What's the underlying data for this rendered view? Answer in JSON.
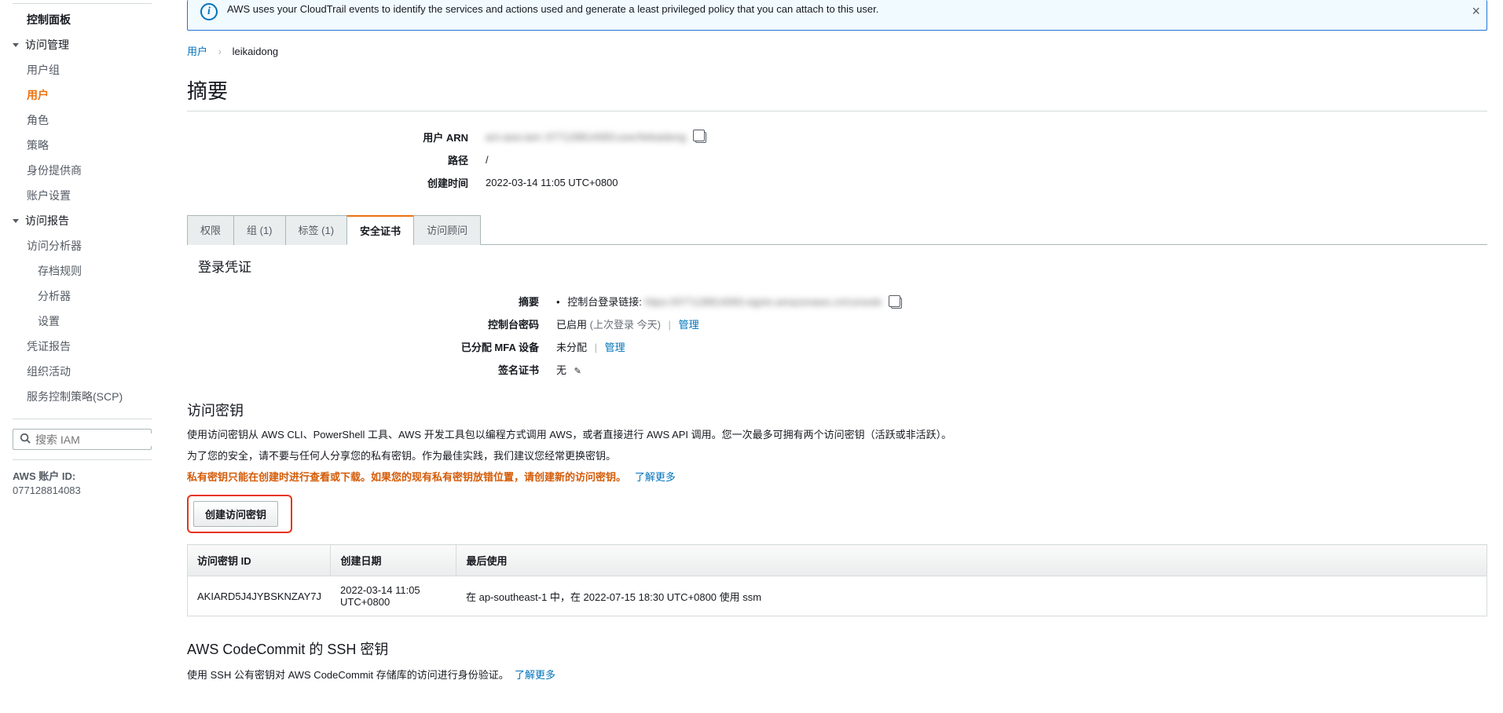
{
  "banner": {
    "text": "AWS uses your CloudTrail events to identify the services and actions used and generate a least privileged policy that you can attach to this user."
  },
  "sidebar": {
    "dashboard": "控制面板",
    "accessMgmt": "访问管理",
    "userGroups": "用户组",
    "users": "用户",
    "roles": "角色",
    "policies": "策略",
    "idProviders": "身份提供商",
    "accountSettings": "账户设置",
    "accessReports": "访问报告",
    "accessAnalyzer": "访问分析器",
    "archiveRules": "存档规则",
    "analyzers": "分析器",
    "settings": "设置",
    "credReport": "凭证报告",
    "orgActivity": "组织活动",
    "scp": "服务控制策略(SCP)",
    "searchPlaceholder": "搜索 IAM",
    "accountLabel": "AWS 账户 ID:",
    "accountId": "077128814083"
  },
  "breadcrumb": {
    "users": "用户",
    "current": "leikaidong"
  },
  "summary": {
    "title": "摘要",
    "arnLabel": "用户 ARN",
    "arnValue": "arn:aws:iam::077128814083:user/leikaidong",
    "pathLabel": "路径",
    "pathValue": "/",
    "createdLabel": "创建时间",
    "createdValue": "2022-03-14 11:05 UTC+0800"
  },
  "tabs": {
    "permissions": "权限",
    "groups": "组 (1)",
    "tags": "标签 (1)",
    "security": "安全证书",
    "advisor": "访问顾问"
  },
  "signin": {
    "title": "登录凭证",
    "summaryLabel": "摘要",
    "consoleLinkPrefix": "控制台登录链接:",
    "consoleLinkValue": "https://077128814083.signin.amazonaws.cn/console",
    "consolePwdLabel": "控制台密码",
    "consolePwdEnabled": "已启用",
    "consolePwdLast": "(上次登录 今天)",
    "manage": "管理",
    "mfaLabel": "已分配 MFA 设备",
    "mfaValue": "未分配",
    "certLabel": "签名证书",
    "certValue": "无"
  },
  "accessKeys": {
    "title": "访问密钥",
    "desc": "使用访问密钥从 AWS CLI、PowerShell 工具、AWS 开发工具包以编程方式调用 AWS，或者直接进行 AWS API 调用。您一次最多可拥有两个访问密钥（活跃或非活跃）。",
    "safety": "为了您的安全，请不要与任何人分享您的私有密钥。作为最佳实践，我们建议您经常更换密钥。",
    "warningOrange": "私有密钥只能在创建时进行查看或下载。如果您的现有私有密钥放错位置，请创建新的访问密钥。",
    "learnMore": "了解更多",
    "createButton": "创建访问密钥",
    "col1": "访问密钥 ID",
    "col2": "创建日期",
    "col3": "最后使用",
    "rows": [
      {
        "id": "AKIARD5J4JYBSKNZAY7J",
        "created": "2022-03-14 11:05 UTC+0800",
        "lastUsed": "在 ap-southeast-1 中，在 2022-07-15 18:30 UTC+0800 使用 ssm"
      }
    ]
  },
  "ssh": {
    "title": "AWS CodeCommit 的 SSH 密钥",
    "desc": "使用 SSH 公有密钥对 AWS CodeCommit 存储库的访问进行身份验证。",
    "learnMore": "了解更多"
  }
}
